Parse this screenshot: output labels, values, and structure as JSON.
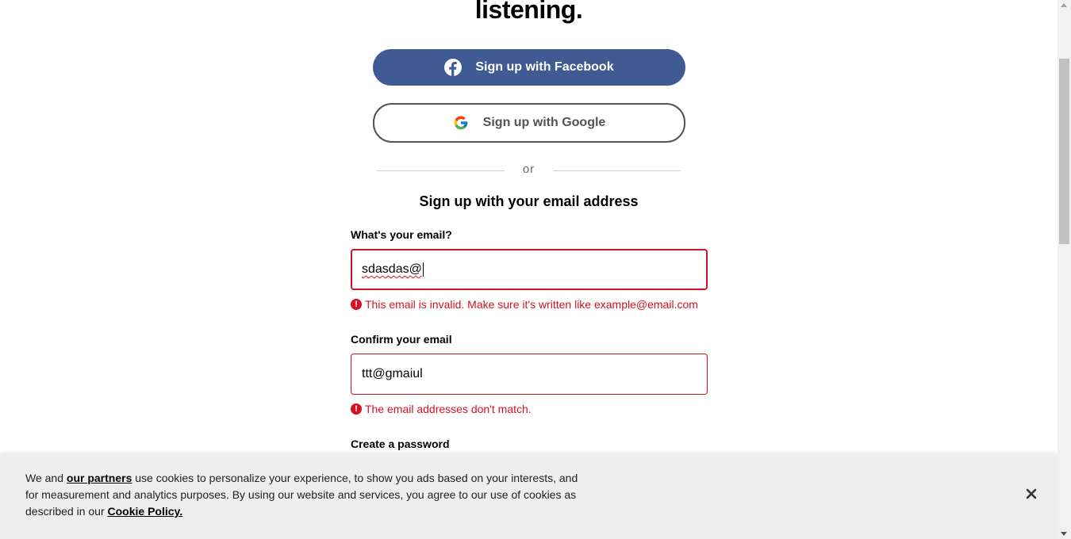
{
  "hero": {
    "title": "listening."
  },
  "social": {
    "facebook_label": "Sign up with Facebook",
    "google_label": "Sign up with Google",
    "facebook_color": "#405a93"
  },
  "divider": {
    "text": "or"
  },
  "form": {
    "title": "Sign up with your email address",
    "email": {
      "label": "What's your email?",
      "value": "sdasdas@",
      "error": "This email is invalid. Make sure it's written like example@email.com"
    },
    "confirm_email": {
      "label": "Confirm your email",
      "value": "ttt@gmaiul",
      "error": "The email addresses don't match."
    },
    "password": {
      "label": "Create a password"
    }
  },
  "cookie_banner": {
    "text_before": "We and ",
    "partners_link": "our partners",
    "text_middle": " use cookies to personalize your experience, to show you ads based on your interests, and for measurement and analytics purposes. By using our website and services, you agree to our use of cookies as described in our ",
    "policy_link": "Cookie Policy.",
    "close_icon": "close-icon"
  },
  "colors": {
    "error": "#d31225",
    "banner_bg": "#eeeeee"
  }
}
